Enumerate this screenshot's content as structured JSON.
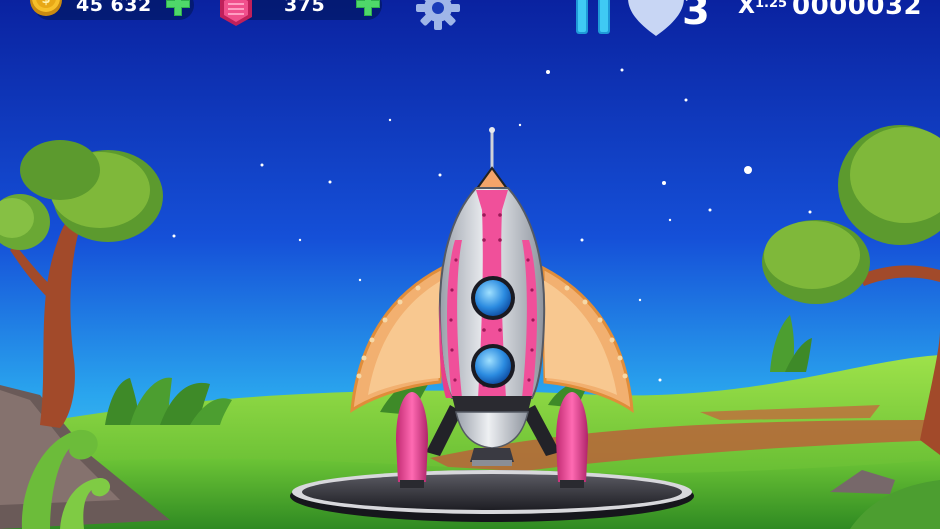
{
  "hud": {
    "coins": {
      "value": "45 632"
    },
    "gems": {
      "value": "375"
    },
    "lives": {
      "value": "3"
    },
    "multiplier": {
      "prefix": "X",
      "value": "1.25"
    },
    "score": {
      "value": "0000032"
    }
  },
  "colors": {
    "sky_top": "#0a2aa8",
    "sky_bottom": "#2fb8f0",
    "grass": "#7fd13a",
    "rocket_pink": "#f0509a",
    "rocket_silver": "#c8cdd4",
    "wing_orange": "#f4b46a",
    "plus_green": "#3bc85a",
    "pause_cyan": "#35c8f0"
  },
  "icons": [
    "coin-icon",
    "coins-add-icon",
    "gem-icon",
    "gems-add-icon",
    "settings-gear-icon",
    "pause-icon",
    "heart-icon"
  ]
}
